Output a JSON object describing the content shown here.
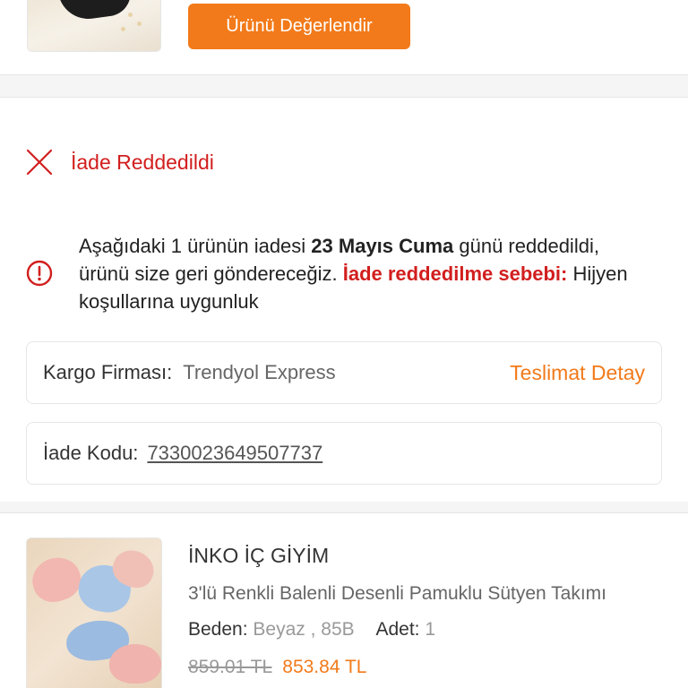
{
  "top": {
    "review_button": "Ürünü Değerlendir"
  },
  "status": {
    "label": "İade Reddedildi",
    "icon": "close-x-icon",
    "color": "#d21e1e"
  },
  "note": {
    "part1": "Aşağıdaki 1 ürünün iadesi ",
    "date": "23 Mayıs Cuma",
    "part2": " günü reddedildi, ürünü size geri göndereceğiz. ",
    "reason_label": "İade reddedilme sebebi:",
    "reason": " Hijyen koşullarına uygunluk"
  },
  "shipping": {
    "label": "Kargo Firması:",
    "value": "Trendyol Express",
    "link": "Teslimat Detay"
  },
  "return_code": {
    "label": "İade Kodu:",
    "value": "7330023649507737"
  },
  "product": {
    "brand": "İNKO İÇ GİYİM",
    "name": "3'lü Renkli Balenli Desenli Pamuklu Sütyen Takımı",
    "size_label": "Beden:",
    "size_value": "Beyaz , 85B",
    "qty_label": "Adet:",
    "qty_value": "1",
    "old_price": "859.01 TL",
    "new_price": "853.84 TL"
  },
  "colors": {
    "accent": "#f27a1a",
    "danger": "#d21e1e"
  }
}
